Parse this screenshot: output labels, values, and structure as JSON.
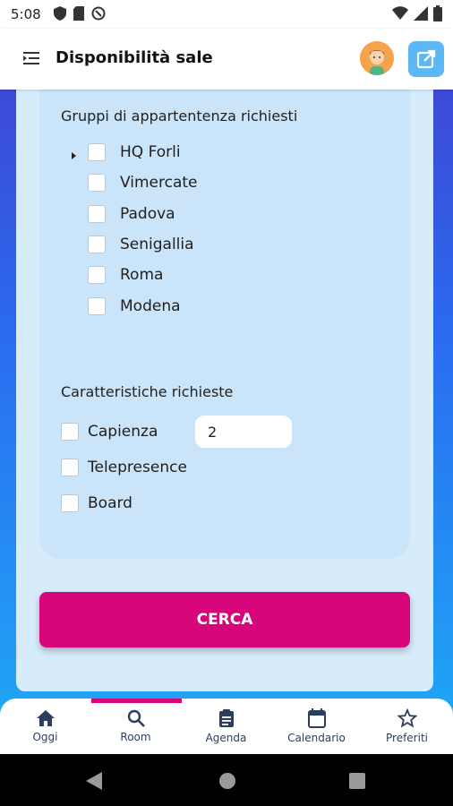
{
  "status_bar": {
    "time": "5:08"
  },
  "app_bar": {
    "title": "Disponibilità sale"
  },
  "groups": {
    "title": "Gruppi di appartentenza richiesti",
    "items": [
      "HQ Forli",
      "Vimercate",
      "Padova",
      "Senigallia",
      "Roma",
      "Modena"
    ]
  },
  "features": {
    "title": "Caratteristiche richieste",
    "items": [
      "Capienza",
      "Telepresence",
      "Board"
    ],
    "capacity_value": "2"
  },
  "search_button": {
    "label": "CERCA"
  },
  "colors": {
    "accent": "#d7077b",
    "panel": "#d6ecfb",
    "card": "#cae4fa",
    "nav_text": "#2c3e5e"
  },
  "bottom_nav": {
    "items": [
      {
        "label": "Oggi",
        "icon": "home-icon"
      },
      {
        "label": "Room",
        "icon": "search-icon"
      },
      {
        "label": "Agenda",
        "icon": "clipboard-icon"
      },
      {
        "label": "Calendario",
        "icon": "calendar-icon"
      },
      {
        "label": "Preferiti",
        "icon": "star-icon"
      }
    ],
    "active_index": 1
  }
}
